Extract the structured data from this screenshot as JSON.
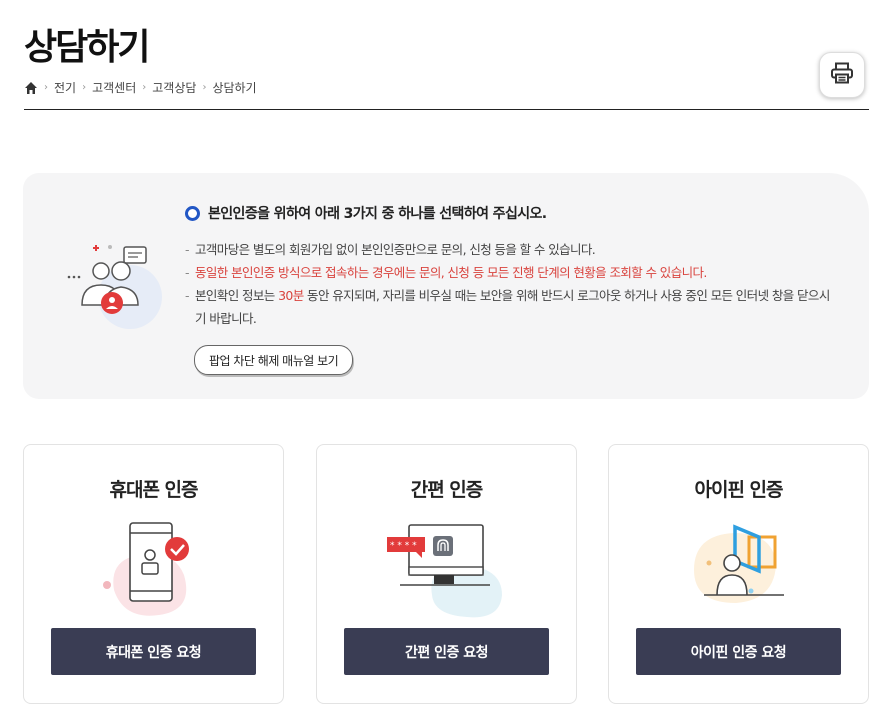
{
  "page": {
    "title": "상담하기",
    "breadcrumb": [
      "전기",
      "고객센터",
      "고객상담",
      "상담하기"
    ]
  },
  "toolbar": {
    "print_icon": "printer-icon"
  },
  "notice": {
    "heading": "본인인증을 위하여 아래 3가지 중 하나를 선택하여 주십시오.",
    "note1": "고객마당은 별도의 회원가입 없이 본인인증만으로 문의, 신청 등을 할 수 있습니다.",
    "note2": "동일한 본인인증 방식으로 접속하는 경우에는 문의, 신청 등 모든 진행 단계의 현황을 조회할 수 있습니다.",
    "note3_pre": "본인확인 정보는 ",
    "note3_highlight": "30분",
    "note3_post": " 동안 유지되며, 자리를 비우실 때는 보안을 위해 반드시 로그아웃 하거나 사용 중인 모든 인터넷 창을 닫으시기 바랍니다.",
    "popup_button": "팝업 차단 해제 매뉴얼 보기"
  },
  "methods": [
    {
      "title": "휴대폰 인증",
      "button": "휴대폰 인증 요청",
      "icon": "mobile-phone-icon"
    },
    {
      "title": "간편 인증",
      "button": "간편 인증 요청",
      "icon": "monitor-fingerprint-icon"
    },
    {
      "title": "아이핀 인증",
      "button": "아이핀 인증 요청",
      "icon": "ipin-icon"
    }
  ],
  "colors": {
    "accent_blue": "#2257c5",
    "highlight_red": "#d9433e",
    "button_dark": "#3a3d54"
  }
}
